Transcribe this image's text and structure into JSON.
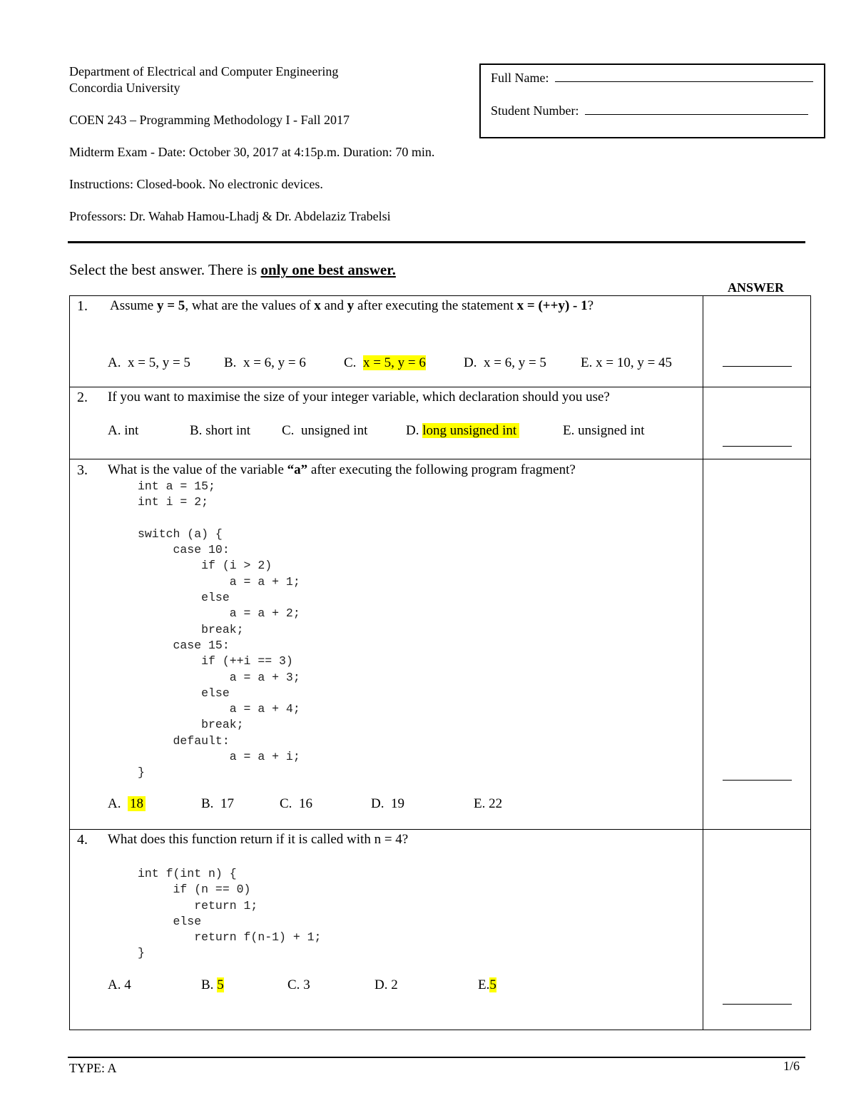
{
  "header": {
    "department": "Department of Electrical and Computer Engineering",
    "university": "Concordia University",
    "course": "COEN 243 – Programming Methodology I - Fall 2017",
    "exam_info": "Midterm Exam - Date: October 30, 2017 at 4:15p.m. Duration: 70 min.",
    "instructions": "Instructions: Closed-book. No electronic devices.",
    "professors": "Professors: Dr. Wahab Hamou-Lhadj & Dr. Abdelaziz Trabelsi"
  },
  "name_box": {
    "full_name_label": "Full Name:",
    "full_name_value": "",
    "student_number_label": "Student Number:",
    "student_number_value": ""
  },
  "instruction": {
    "prefix": "Select the best answer. There is ",
    "emphasis": "only one best answer."
  },
  "answer_header": "ANSWER",
  "questions": [
    {
      "number": "1.",
      "text_parts": [
        "Assume ",
        "y = 5",
        ", what are the values of ",
        "x",
        " and ",
        "y",
        " after executing the statement ",
        "x = (++y) - 1",
        "?"
      ],
      "options": [
        {
          "letter": "A.",
          "text": "x = 5, y = 5",
          "highlighted": false
        },
        {
          "letter": "B.",
          "text": "x = 6, y = 6",
          "highlighted": false
        },
        {
          "letter": "C.",
          "text": "x = 5, y = 6",
          "highlighted": true
        },
        {
          "letter": "D.",
          "text": "x = 6, y = 5",
          "highlighted": false
        },
        {
          "letter": "E.",
          "text": "x = 10, y = 45",
          "highlighted": false
        }
      ],
      "answer_value": ""
    },
    {
      "number": "2.",
      "text": "If you want to maximise the size of your integer variable, which declaration should you use?",
      "options": [
        {
          "letter": "A.",
          "text": "int",
          "highlighted": false
        },
        {
          "letter": "B.",
          "text": "short int",
          "highlighted": false
        },
        {
          "letter": "C.",
          "text": "unsigned int",
          "highlighted": false
        },
        {
          "letter": "D.",
          "text": "long unsigned int",
          "highlighted": true
        },
        {
          "letter": "E.",
          "text": "unsigned int",
          "highlighted": false
        }
      ],
      "answer_value": ""
    },
    {
      "number": "3.",
      "text_parts": [
        "What is the value of the variable ",
        "“a”",
        " after executing the following program fragment?"
      ],
      "code": [
        "int a = 15;",
        "int i = 2;",
        "",
        "switch (a) {",
        "     case 10:",
        "         if (i > 2)",
        "             a = a + 1;",
        "         else",
        "             a = a + 2;",
        "         break;",
        "     case 15:",
        "         if (++i == 3)",
        "             a = a + 3;",
        "         else",
        "             a = a + 4;",
        "         break;",
        "     default:",
        "             a = a + i;",
        "}"
      ],
      "options": [
        {
          "letter": "A.",
          "text": "18",
          "highlighted": true
        },
        {
          "letter": "B.",
          "text": "17",
          "highlighted": false
        },
        {
          "letter": "C.",
          "text": "16",
          "highlighted": false
        },
        {
          "letter": "D.",
          "text": "19",
          "highlighted": false
        },
        {
          "letter": "E.",
          "text": "22",
          "highlighted": false
        }
      ],
      "answer_value": ""
    },
    {
      "number": "4.",
      "text": "What does this function return if it is called with n = 4?",
      "code": [
        "int f(int n) {",
        "     if (n == 0)",
        "        return 1;",
        "     else",
        "        return f(n-1) + 1;",
        "}"
      ],
      "options": [
        {
          "letter": "A.",
          "text": "4",
          "highlighted": false
        },
        {
          "letter": "B.",
          "text": "5",
          "highlighted": true
        },
        {
          "letter": "C.",
          "text": "3",
          "highlighted": false
        },
        {
          "letter": "D.",
          "text": "2",
          "highlighted": false
        },
        {
          "letter": "E.",
          "text": "5",
          "highlighted": true
        }
      ],
      "answer_value": ""
    }
  ],
  "footer": {
    "type_label": "TYPE: A",
    "page": "1/6"
  },
  "colors": {
    "highlight": "#ffff00",
    "text": "#000000",
    "code_text": "#222222"
  }
}
